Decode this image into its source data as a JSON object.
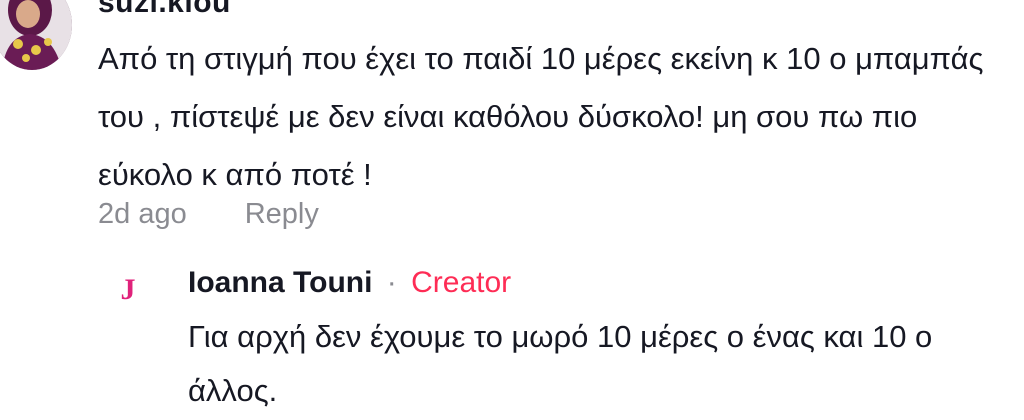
{
  "comment": {
    "username": "suzi.kiou",
    "text": "Από τη στιγμή που έχει το παιδί 10 μέρες εκείνη κ 10 ο μπαμπάς του , πίστεψέ με δεν είναι καθόλου δύσκολο! μη σου πω πιο εύκολο κ από ποτέ !",
    "timestamp": "2d ago",
    "reply_label": "Reply",
    "avatar_icon": "profile-photo-icon"
  },
  "reply": {
    "avatar_letter": "J",
    "author": "Ioanna Touni",
    "separator": "·",
    "badge": "Creator",
    "text": "Για αρχή δεν έχουμε το μωρό 10 μέρες ο ένας και 10 ο άλλος."
  },
  "colors": {
    "text": "#161823",
    "muted": "#8a8b91",
    "creator": "#fe2c55",
    "reply_avatar": "#e0227b"
  }
}
